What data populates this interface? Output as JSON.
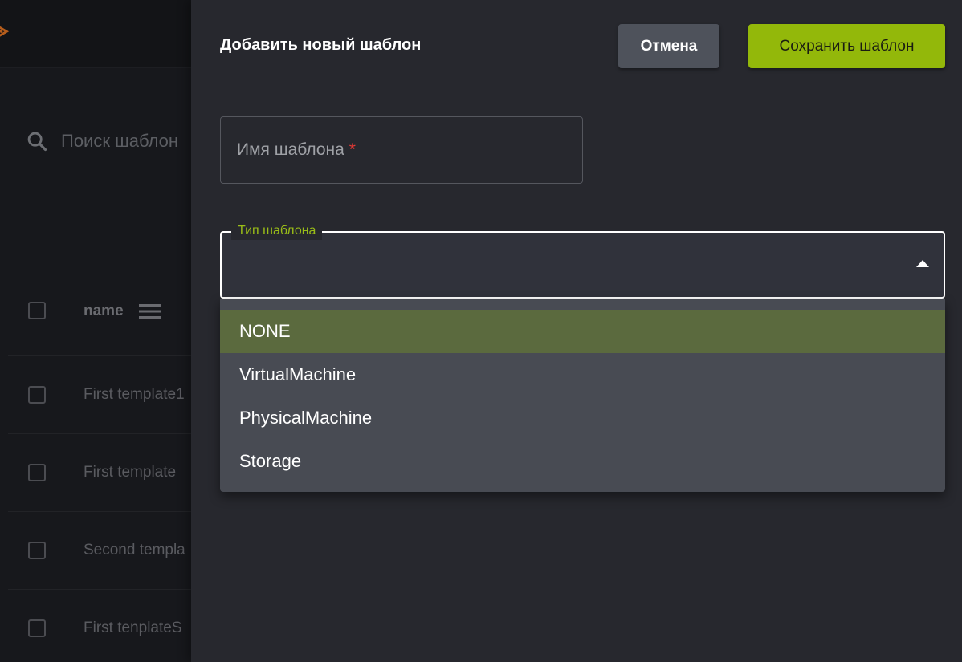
{
  "background": {
    "search": {
      "icon": "search-icon",
      "placeholder": "Поиск шаблон"
    },
    "table": {
      "column_name": "name",
      "menu_icon": "menu-icon",
      "rows": [
        {
          "name": "First template1"
        },
        {
          "name": "First template"
        },
        {
          "name": "Second templa"
        },
        {
          "name": "First tenplateS"
        }
      ]
    }
  },
  "drawer": {
    "title": "Добавить новый шаблон",
    "cancel_label": "Отмена",
    "save_label": "Сохранить шаблон",
    "name_field": {
      "placeholder": "Имя шаблона",
      "required_mark": "*"
    },
    "type_field": {
      "label": "Тип шаблона",
      "value": "",
      "arrow_icon": "arrow-up-icon",
      "options": [
        "NONE",
        "VirtualMachine",
        "PhysicalMachine",
        "Storage"
      ],
      "highlighted": "NONE"
    }
  },
  "colors": {
    "accent": "#93b80a",
    "label_accent": "#9abd18",
    "drawer_bg": "#27282e",
    "dropdown_bg": "#484b53",
    "highlight_bg": "#5b6a3e",
    "required": "#e53935",
    "cancel_bg": "#4e525b"
  }
}
